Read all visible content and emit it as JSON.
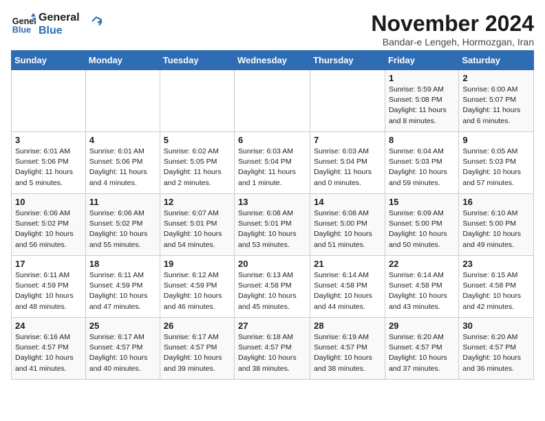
{
  "logo": {
    "line1": "General",
    "line2": "Blue"
  },
  "title": "November 2024",
  "subtitle": "Bandar-e Lengeh, Hormozgan, Iran",
  "days_of_week": [
    "Sunday",
    "Monday",
    "Tuesday",
    "Wednesday",
    "Thursday",
    "Friday",
    "Saturday"
  ],
  "weeks": [
    [
      {
        "day": "",
        "info": ""
      },
      {
        "day": "",
        "info": ""
      },
      {
        "day": "",
        "info": ""
      },
      {
        "day": "",
        "info": ""
      },
      {
        "day": "",
        "info": ""
      },
      {
        "day": "1",
        "info": "Sunrise: 5:59 AM\nSunset: 5:08 PM\nDaylight: 11 hours and 8 minutes."
      },
      {
        "day": "2",
        "info": "Sunrise: 6:00 AM\nSunset: 5:07 PM\nDaylight: 11 hours and 6 minutes."
      }
    ],
    [
      {
        "day": "3",
        "info": "Sunrise: 6:01 AM\nSunset: 5:06 PM\nDaylight: 11 hours and 5 minutes."
      },
      {
        "day": "4",
        "info": "Sunrise: 6:01 AM\nSunset: 5:06 PM\nDaylight: 11 hours and 4 minutes."
      },
      {
        "day": "5",
        "info": "Sunrise: 6:02 AM\nSunset: 5:05 PM\nDaylight: 11 hours and 2 minutes."
      },
      {
        "day": "6",
        "info": "Sunrise: 6:03 AM\nSunset: 5:04 PM\nDaylight: 11 hours and 1 minute."
      },
      {
        "day": "7",
        "info": "Sunrise: 6:03 AM\nSunset: 5:04 PM\nDaylight: 11 hours and 0 minutes."
      },
      {
        "day": "8",
        "info": "Sunrise: 6:04 AM\nSunset: 5:03 PM\nDaylight: 10 hours and 59 minutes."
      },
      {
        "day": "9",
        "info": "Sunrise: 6:05 AM\nSunset: 5:03 PM\nDaylight: 10 hours and 57 minutes."
      }
    ],
    [
      {
        "day": "10",
        "info": "Sunrise: 6:06 AM\nSunset: 5:02 PM\nDaylight: 10 hours and 56 minutes."
      },
      {
        "day": "11",
        "info": "Sunrise: 6:06 AM\nSunset: 5:02 PM\nDaylight: 10 hours and 55 minutes."
      },
      {
        "day": "12",
        "info": "Sunrise: 6:07 AM\nSunset: 5:01 PM\nDaylight: 10 hours and 54 minutes."
      },
      {
        "day": "13",
        "info": "Sunrise: 6:08 AM\nSunset: 5:01 PM\nDaylight: 10 hours and 53 minutes."
      },
      {
        "day": "14",
        "info": "Sunrise: 6:08 AM\nSunset: 5:00 PM\nDaylight: 10 hours and 51 minutes."
      },
      {
        "day": "15",
        "info": "Sunrise: 6:09 AM\nSunset: 5:00 PM\nDaylight: 10 hours and 50 minutes."
      },
      {
        "day": "16",
        "info": "Sunrise: 6:10 AM\nSunset: 5:00 PM\nDaylight: 10 hours and 49 minutes."
      }
    ],
    [
      {
        "day": "17",
        "info": "Sunrise: 6:11 AM\nSunset: 4:59 PM\nDaylight: 10 hours and 48 minutes."
      },
      {
        "day": "18",
        "info": "Sunrise: 6:11 AM\nSunset: 4:59 PM\nDaylight: 10 hours and 47 minutes."
      },
      {
        "day": "19",
        "info": "Sunrise: 6:12 AM\nSunset: 4:59 PM\nDaylight: 10 hours and 46 minutes."
      },
      {
        "day": "20",
        "info": "Sunrise: 6:13 AM\nSunset: 4:58 PM\nDaylight: 10 hours and 45 minutes."
      },
      {
        "day": "21",
        "info": "Sunrise: 6:14 AM\nSunset: 4:58 PM\nDaylight: 10 hours and 44 minutes."
      },
      {
        "day": "22",
        "info": "Sunrise: 6:14 AM\nSunset: 4:58 PM\nDaylight: 10 hours and 43 minutes."
      },
      {
        "day": "23",
        "info": "Sunrise: 6:15 AM\nSunset: 4:58 PM\nDaylight: 10 hours and 42 minutes."
      }
    ],
    [
      {
        "day": "24",
        "info": "Sunrise: 6:16 AM\nSunset: 4:57 PM\nDaylight: 10 hours and 41 minutes."
      },
      {
        "day": "25",
        "info": "Sunrise: 6:17 AM\nSunset: 4:57 PM\nDaylight: 10 hours and 40 minutes."
      },
      {
        "day": "26",
        "info": "Sunrise: 6:17 AM\nSunset: 4:57 PM\nDaylight: 10 hours and 39 minutes."
      },
      {
        "day": "27",
        "info": "Sunrise: 6:18 AM\nSunset: 4:57 PM\nDaylight: 10 hours and 38 minutes."
      },
      {
        "day": "28",
        "info": "Sunrise: 6:19 AM\nSunset: 4:57 PM\nDaylight: 10 hours and 38 minutes."
      },
      {
        "day": "29",
        "info": "Sunrise: 6:20 AM\nSunset: 4:57 PM\nDaylight: 10 hours and 37 minutes."
      },
      {
        "day": "30",
        "info": "Sunrise: 6:20 AM\nSunset: 4:57 PM\nDaylight: 10 hours and 36 minutes."
      }
    ]
  ]
}
